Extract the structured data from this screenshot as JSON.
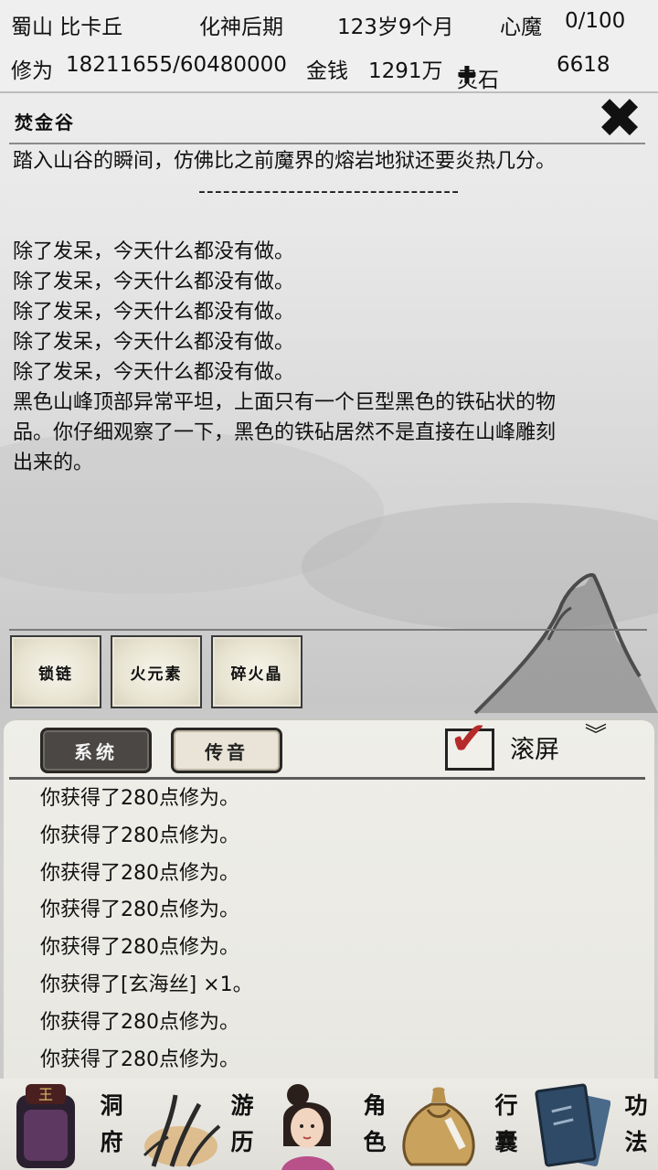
{
  "header": {
    "location_name": "蜀山 比卡丘",
    "realm": "化神后期",
    "age": "123岁9个月",
    "heart_demon_label": "心魔",
    "heart_demon_value": "0/100",
    "cultivation_label": "修为",
    "cultivation_value": "18211655/60480000",
    "money_label": "金钱",
    "money_value": "1291万",
    "spirit_stone_label": "灵石",
    "spirit_stone_value": "6618"
  },
  "story": {
    "place": "焚金谷",
    "intro": "踏入山谷的瞬间，仿佛比之前魔界的熔岩地狱还要炎热几分。",
    "divider": "--------------------------------",
    "lines": [
      "除了发呆，今天什么都没有做。",
      "除了发呆，今天什么都没有做。",
      "除了发呆，今天什么都没有做。",
      "除了发呆，今天什么都没有做。",
      "除了发呆，今天什么都没有做。"
    ],
    "paragraph_lines": [
      "黑色山峰顶部异常平坦，上面只有一个巨型黑色的铁砧状的物",
      "品。你仔细观察了一下，黑色的铁砧居然不是直接在山峰雕刻",
      "出来的。"
    ]
  },
  "items": [
    "锁链",
    "火元素",
    "碎火晶"
  ],
  "messages": {
    "tabs": [
      "系统",
      "传音"
    ],
    "scroll_label": "滚屏",
    "scroll_checked": true,
    "lines": [
      "你获得了280点修为。",
      "你获得了280点修为。",
      "你获得了280点修为。",
      "你获得了280点修为。",
      "你获得了280点修为。",
      "你获得了[玄海丝] ×1。",
      "你获得了280点修为。",
      "你获得了280点修为。"
    ]
  },
  "nav": {
    "items": [
      {
        "top": "洞",
        "bottom": "府",
        "icon": "house-icon"
      },
      {
        "top": "游",
        "bottom": "历",
        "icon": "grass-icon"
      },
      {
        "top": "角",
        "bottom": "色",
        "icon": "character-portrait-icon"
      },
      {
        "top": "行",
        "bottom": "囊",
        "icon": "bag-icon"
      },
      {
        "top": "功",
        "bottom": "法",
        "icon": "book-icon"
      }
    ]
  },
  "colors": {
    "checkmark": "#b52a2a",
    "tab_active": "#4a4744"
  }
}
